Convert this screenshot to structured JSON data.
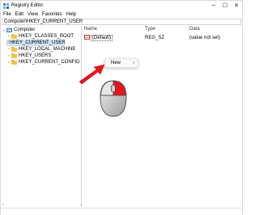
{
  "window": {
    "title": "Registry Editor",
    "controls": {
      "minimize": "─",
      "maximize": "☐",
      "close": "✕"
    }
  },
  "menu": [
    "File",
    "Edit",
    "View",
    "Favorites",
    "Help"
  ],
  "address": "Computer\\HKEY_CURRENT_USER",
  "tree": {
    "root": {
      "label": "Computer",
      "expanded": true
    },
    "items": [
      {
        "label": "HKEY_CLASSES_ROOT",
        "selected": false
      },
      {
        "label": "HKEY_CURRENT_USER",
        "selected": true
      },
      {
        "label": "HKEY_LOCAL_MACHINE",
        "selected": false
      },
      {
        "label": "HKEY_USERS",
        "selected": false
      },
      {
        "label": "HKEY_CURRENT_CONFIG",
        "selected": false
      }
    ]
  },
  "list": {
    "columns": {
      "name": "Name",
      "type": "Type",
      "data": "Data"
    },
    "rows": [
      {
        "icon": "string-value-icon",
        "icon_text": "ab",
        "name": "(Default)",
        "type": "REG_SZ",
        "data": "(value not set)"
      }
    ]
  },
  "context_menu": {
    "items": [
      {
        "label": "New",
        "submenu_arrow": "›"
      }
    ]
  },
  "annotation": {
    "arrow_color": "#e8141c",
    "mouse_highlight": "right-button",
    "mouse_highlight_color": "#e8141c"
  },
  "colors": {
    "selection": "#cde3f7",
    "folder": "#f4c542"
  }
}
